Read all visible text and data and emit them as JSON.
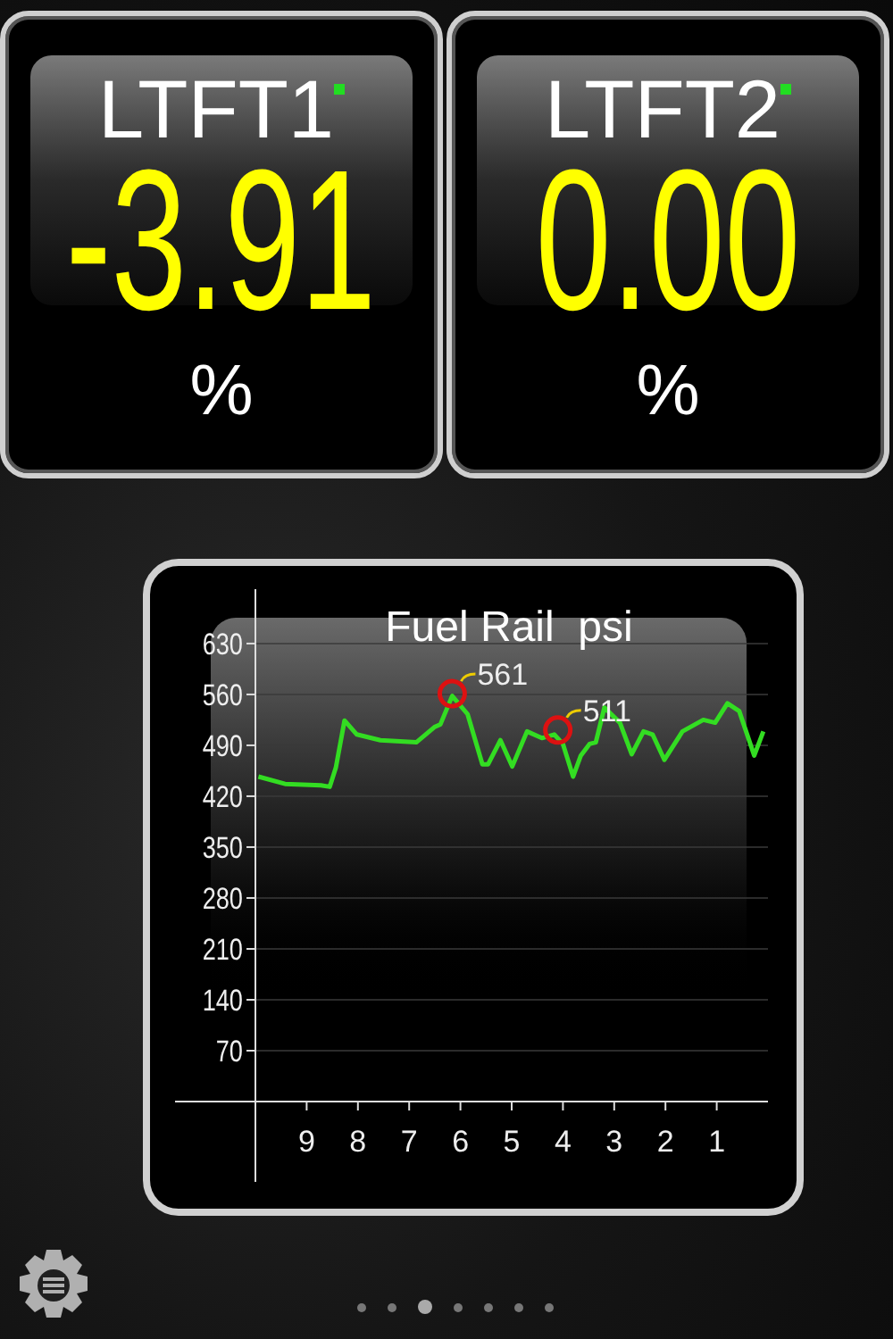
{
  "gauges": [
    {
      "title": "LTFT1",
      "value": "-3.91",
      "unit": "%"
    },
    {
      "title": "LTFT2",
      "value": "0.00",
      "unit": "%"
    }
  ],
  "graph": {
    "title": "Fuel Rail  psi",
    "chart_data": {
      "type": "line",
      "x": [
        9.94,
        9.42,
        8.72,
        8.55,
        8.43,
        8.26,
        8.02,
        7.56,
        6.86,
        6.51,
        6.39,
        6.16,
        5.86,
        5.57,
        5.46,
        5.22,
        4.99,
        4.7,
        4.41,
        4.17,
        4.0,
        3.8,
        3.65,
        3.48,
        3.36,
        3.19,
        2.89,
        2.66,
        2.43,
        2.25,
        2.02,
        1.67,
        1.26,
        1.03,
        0.79,
        0.56,
        0.27,
        0.09
      ],
      "grid": true,
      "series": [
        {
          "color": "#33dd22",
          "values": [
            447,
            437,
            435,
            433,
            460,
            524,
            505,
            497,
            494,
            515,
            519,
            558,
            533,
            464,
            464,
            497,
            461,
            509,
            500,
            505,
            492,
            447,
            476,
            492,
            494,
            542,
            521,
            478,
            509,
            505,
            470,
            509,
            525,
            521,
            548,
            537,
            476,
            509
          ]
        }
      ],
      "xlim": [
        10,
        0
      ],
      "ylim": [
        0,
        700
      ],
      "xticks": [
        9,
        8,
        7,
        6,
        5,
        4,
        3,
        2,
        1
      ],
      "yticks": [
        70,
        140,
        210,
        280,
        350,
        420,
        490,
        560,
        630
      ],
      "annotations": [
        {
          "x": 6.16,
          "y": 561,
          "text": "561"
        },
        {
          "x": 4.1,
          "y": 511,
          "text": "511"
        }
      ]
    }
  },
  "pager": [
    {
      "selected": false
    },
    {
      "selected": false
    },
    {
      "selected": true
    },
    {
      "selected": false
    },
    {
      "selected": false
    },
    {
      "selected": false
    },
    {
      "selected": false
    }
  ]
}
